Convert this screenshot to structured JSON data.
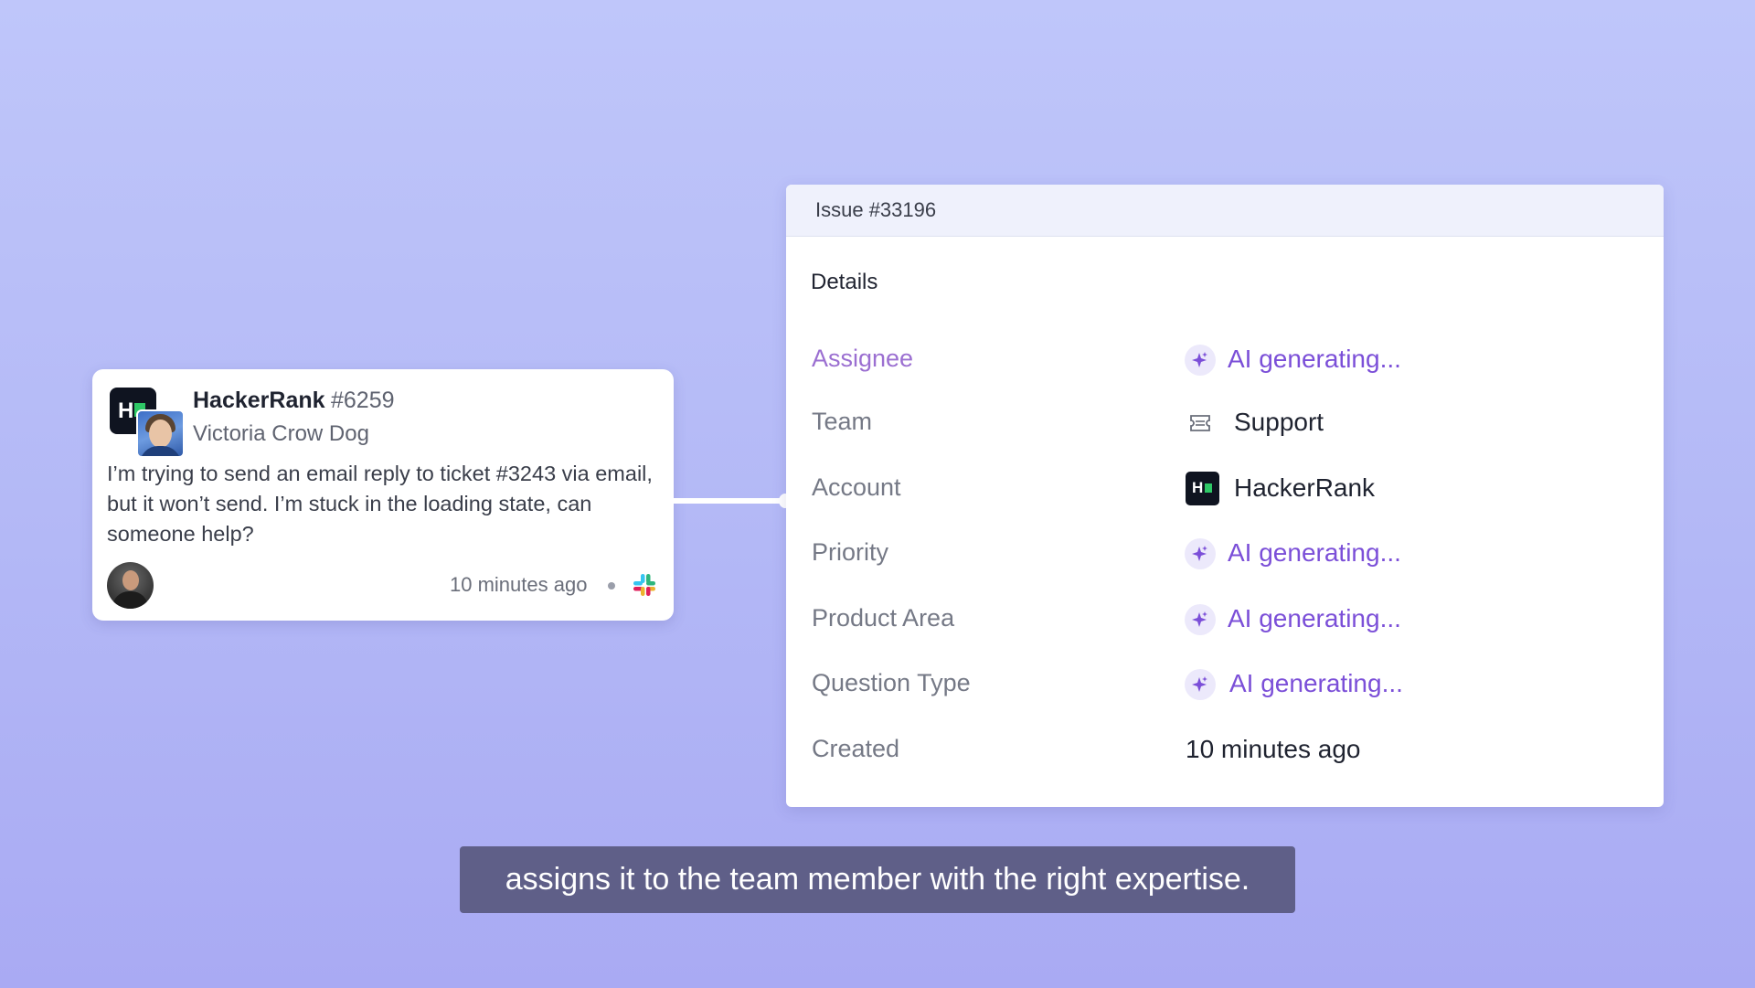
{
  "message": {
    "org_name": "HackerRank",
    "ticket_number": "#6259",
    "user_name": "Victoria Crow Dog",
    "body": "I’m trying to send an email reply to ticket #3243 via email, but it won’t send. I’m stuck in the loading state, can someone help?",
    "time": "10 minutes ago",
    "source_icon": "slack-icon"
  },
  "issue": {
    "title": "Issue #33196",
    "section_title": "Details",
    "rows": [
      {
        "label": "Assignee",
        "value": "AI generating...",
        "icon": "sparkle-icon"
      },
      {
        "label": "Team",
        "value": "Support",
        "icon": "ticket-icon"
      },
      {
        "label": "Account",
        "value": "HackerRank",
        "icon": "hackerrank-logo"
      },
      {
        "label": "Priority",
        "value": "AI generating...",
        "icon": "sparkle-icon"
      },
      {
        "label": "Product Area",
        "value": "AI generating...",
        "icon": "sparkle-icon"
      },
      {
        "label": "Question Type",
        "value": "AI generating...",
        "icon": "sparkle-icon"
      },
      {
        "label": "Created",
        "value": "10 minutes ago",
        "icon": ""
      }
    ]
  },
  "caption": "assigns it to the team member with the right expertise.",
  "colors": {
    "background": "#b6bcf7",
    "ai_purple": "#7b4fd8",
    "active_label": "#9b6fd1",
    "caption_bg": "#5f5f88",
    "hackerrank_green": "#2ec866"
  }
}
